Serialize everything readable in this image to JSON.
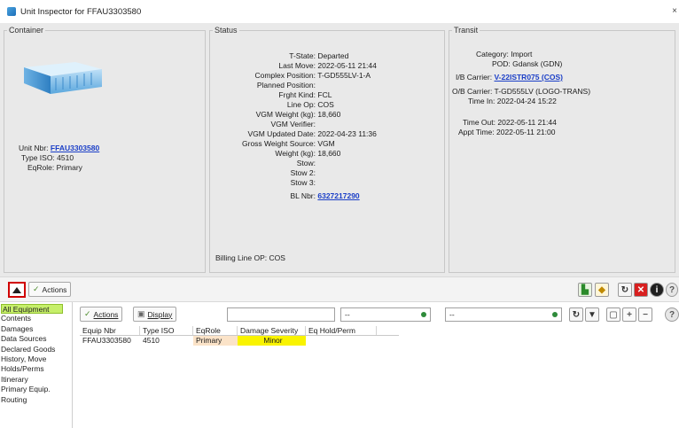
{
  "window": {
    "title": "Unit Inspector for FFAU3303580",
    "close": "×"
  },
  "container_panel": {
    "legend": "Container",
    "unit_nbr_label": "Unit Nbr:",
    "unit_nbr": "FFAU3303580",
    "type_iso_label": "Type ISO:",
    "type_iso": "4510",
    "eqrole_label": "EqRole:",
    "eqrole": "Primary"
  },
  "status_panel": {
    "legend": "Status",
    "rows": [
      {
        "k": "T-State:",
        "v": "Departed"
      },
      {
        "k": "Last Move:",
        "v": "2022-05-11 21:44"
      },
      {
        "k": "Complex Position:",
        "v": "T-GD555LV-1-A"
      },
      {
        "k": "Planned Position:",
        "v": ""
      },
      {
        "k": "Frght Kind:",
        "v": "FCL"
      },
      {
        "k": "Line Op:",
        "v": "COS"
      },
      {
        "k": "VGM Weight (kg):",
        "v": "18,660"
      },
      {
        "k": "VGM Verifier:",
        "v": ""
      },
      {
        "k": "VGM Updated Date:",
        "v": "2022-04-23 11:36"
      },
      {
        "k": "Gross Weight Source:",
        "v": "VGM"
      },
      {
        "k": "Weight (kg):",
        "v": "18,660"
      },
      {
        "k": "Stow:",
        "v": ""
      },
      {
        "k": "Stow 2:",
        "v": ""
      },
      {
        "k": "Stow 3:",
        "v": ""
      }
    ],
    "bl_nbr_label": "BL Nbr:",
    "bl_nbr": "6327217290",
    "billing_line_op": "Billing Line OP: COS"
  },
  "transit_panel": {
    "legend": "Transit",
    "category": "Category: Import",
    "pod": "POD: Gdansk (GDN)",
    "ib_carrier_label": "I/B Carrier:",
    "ib_carrier": "V-22ISTR075 (COS)",
    "ob_carrier": "O/B Carrier: T-GD555LV (LOGO-TRANS)",
    "time_in": "Time In: 2022-04-24 15:22",
    "time_out": "Time Out: 2022-05-11 21:44",
    "appt_time": "Appt Time: 2022-05-11 21:00"
  },
  "toolbar": {
    "actions_label": "Actions"
  },
  "sidebar": {
    "items": [
      "All Equipment",
      "Contents",
      "Damages",
      "Data Sources",
      "Declared Goods",
      "History, Move",
      "Holds/Perms",
      "Itinerary",
      "Primary Equip.",
      "Routing"
    ]
  },
  "equipment": {
    "actions_label": "Actions",
    "display_label": "Display",
    "filter1_value": "",
    "combo1_value": "--",
    "combo2_value": "--",
    "columns": [
      "Equip Nbr",
      "Type ISO",
      "EqRole",
      "Damage Severity",
      "Eq Hold/Perm"
    ],
    "rows": [
      {
        "equip_nbr": "FFAU3303580",
        "type_iso": "4510",
        "eqrole": "Primary",
        "damage_severity": "Minor",
        "hold_perm": ""
      }
    ]
  }
}
